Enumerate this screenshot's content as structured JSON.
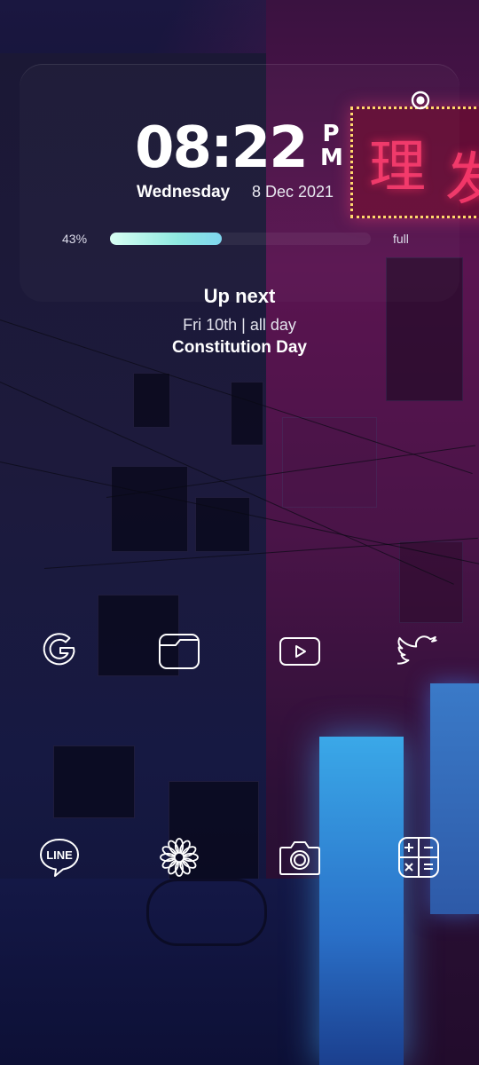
{
  "clock": {
    "time": "08:22",
    "ampm_top": "P",
    "ampm_bottom": "M",
    "day": "Wednesday",
    "date": "8 Dec 2021"
  },
  "battery": {
    "percent_label": "43%",
    "level": 0.43,
    "status": "full",
    "fill_colors": [
      "#d9fff3",
      "#7fd6ef"
    ]
  },
  "upcoming": {
    "heading": "Up next",
    "when": "Fri 10th | all day",
    "title": "Constitution Day"
  },
  "apps": {
    "row1": [
      {
        "name": "Google",
        "icon": "google-icon"
      },
      {
        "name": "Files",
        "icon": "folder-icon"
      },
      {
        "name": "YouTube",
        "icon": "youtube-icon"
      },
      {
        "name": "Twitter",
        "icon": "twitter-icon"
      }
    ],
    "row2": [
      {
        "name": "LINE",
        "icon": "line-icon",
        "label": "LINE"
      },
      {
        "name": "Gallery",
        "icon": "flower-icon"
      },
      {
        "name": "Camera",
        "icon": "camera-icon"
      },
      {
        "name": "Calculator",
        "icon": "calculator-icon"
      }
    ]
  },
  "colors": {
    "text": "#ffffff",
    "neon_pink": "#ff3c6e",
    "neon_blue": "#3aa8e8"
  }
}
